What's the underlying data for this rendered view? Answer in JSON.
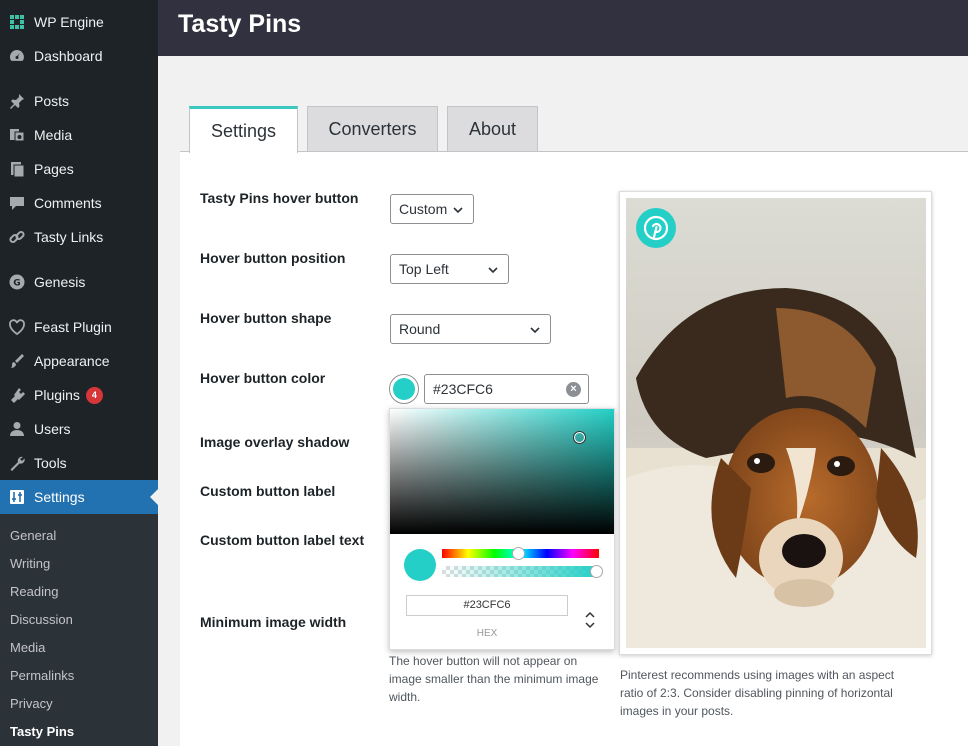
{
  "sidebar": {
    "items": [
      {
        "label": "WP Engine",
        "icon": "wp-engine-icon"
      },
      {
        "label": "Dashboard",
        "icon": "dashboard-icon"
      },
      {
        "label": "Posts",
        "icon": "pin-icon"
      },
      {
        "label": "Media",
        "icon": "media-icon"
      },
      {
        "label": "Pages",
        "icon": "pages-icon"
      },
      {
        "label": "Comments",
        "icon": "comments-icon"
      },
      {
        "label": "Tasty Links",
        "icon": "link-icon"
      },
      {
        "label": "Genesis",
        "icon": "genesis-icon"
      },
      {
        "label": "Feast Plugin",
        "icon": "heart-icon"
      },
      {
        "label": "Appearance",
        "icon": "brush-icon"
      },
      {
        "label": "Plugins",
        "icon": "plugin-icon",
        "badge": "4"
      },
      {
        "label": "Users",
        "icon": "user-icon"
      },
      {
        "label": "Tools",
        "icon": "wrench-icon"
      },
      {
        "label": "Settings",
        "icon": "settings-icon"
      }
    ],
    "submenu": [
      "General",
      "Writing",
      "Reading",
      "Discussion",
      "Media",
      "Permalinks",
      "Privacy",
      "Tasty Pins"
    ]
  },
  "header": {
    "title": "Tasty Pins"
  },
  "tabs": [
    {
      "label": "Settings"
    },
    {
      "label": "Converters"
    },
    {
      "label": "About"
    }
  ],
  "form": {
    "hover_button": {
      "label": "Tasty Pins hover button",
      "value": "Custom"
    },
    "position": {
      "label": "Hover button position",
      "value": "Top Left"
    },
    "shape": {
      "label": "Hover button shape",
      "value": "Round"
    },
    "color": {
      "label": "Hover button color",
      "value": "#23CFC6"
    },
    "overlay": {
      "label": "Image overlay shadow"
    },
    "custom_label": {
      "label": "Custom button label"
    },
    "custom_label_text": {
      "label": "Custom button label text"
    },
    "min_width": {
      "label": "Minimum image width",
      "help": "The hover button will not appear on image smaller than the minimum image width."
    }
  },
  "picker": {
    "hex": "#23CFC6",
    "mode_label": "HEX"
  },
  "preview": {
    "note": "Pinterest recommends using images with an aspect ratio of 2:3. Consider disabling pinning of horizontal images in your posts."
  },
  "colors": {
    "accent": "#23CFC6",
    "sidebar": "#1d2327",
    "active": "#2271b1",
    "header": "#32313f"
  }
}
